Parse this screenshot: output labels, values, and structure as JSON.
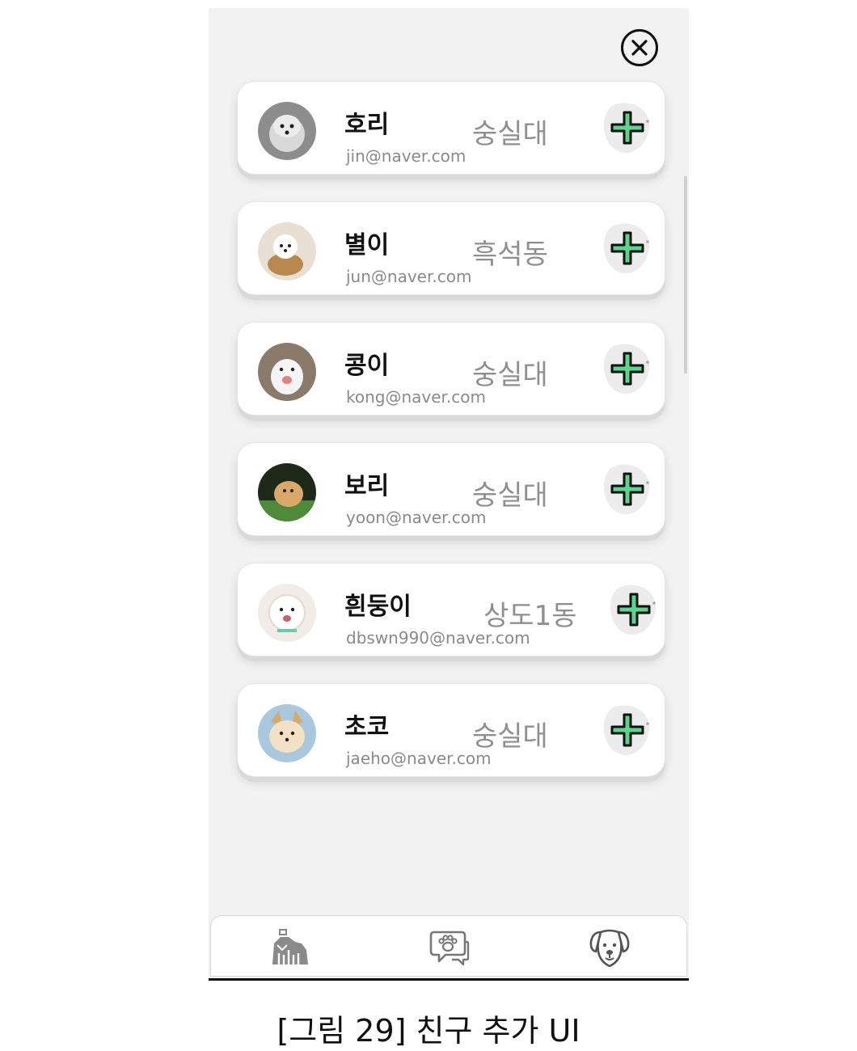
{
  "friends": [
    {
      "name": "호리",
      "email": "jin@naver.com",
      "place": "숭실대"
    },
    {
      "name": "별이",
      "email": "jun@naver.com",
      "place": "흑석동"
    },
    {
      "name": "콩이",
      "email": "kong@naver.com",
      "place": "숭실대"
    },
    {
      "name": "보리",
      "email": "yoon@naver.com",
      "place": "숭실대"
    },
    {
      "name": "흰둥이",
      "email": "dbswn990@naver.com",
      "place": "상도1동"
    },
    {
      "name": "초코",
      "email": "jaeho@naver.com",
      "place": "숭실대"
    }
  ],
  "colors": {
    "accent": "#58d68d",
    "background": "#f2f2f2"
  },
  "icons": {
    "close": "close-circle-icon",
    "add": "plus-icon",
    "nav": [
      "dog-walk-icon",
      "paw-chat-icon",
      "dog-face-icon"
    ]
  },
  "caption": "[그림 29] 친구 추가 UI"
}
